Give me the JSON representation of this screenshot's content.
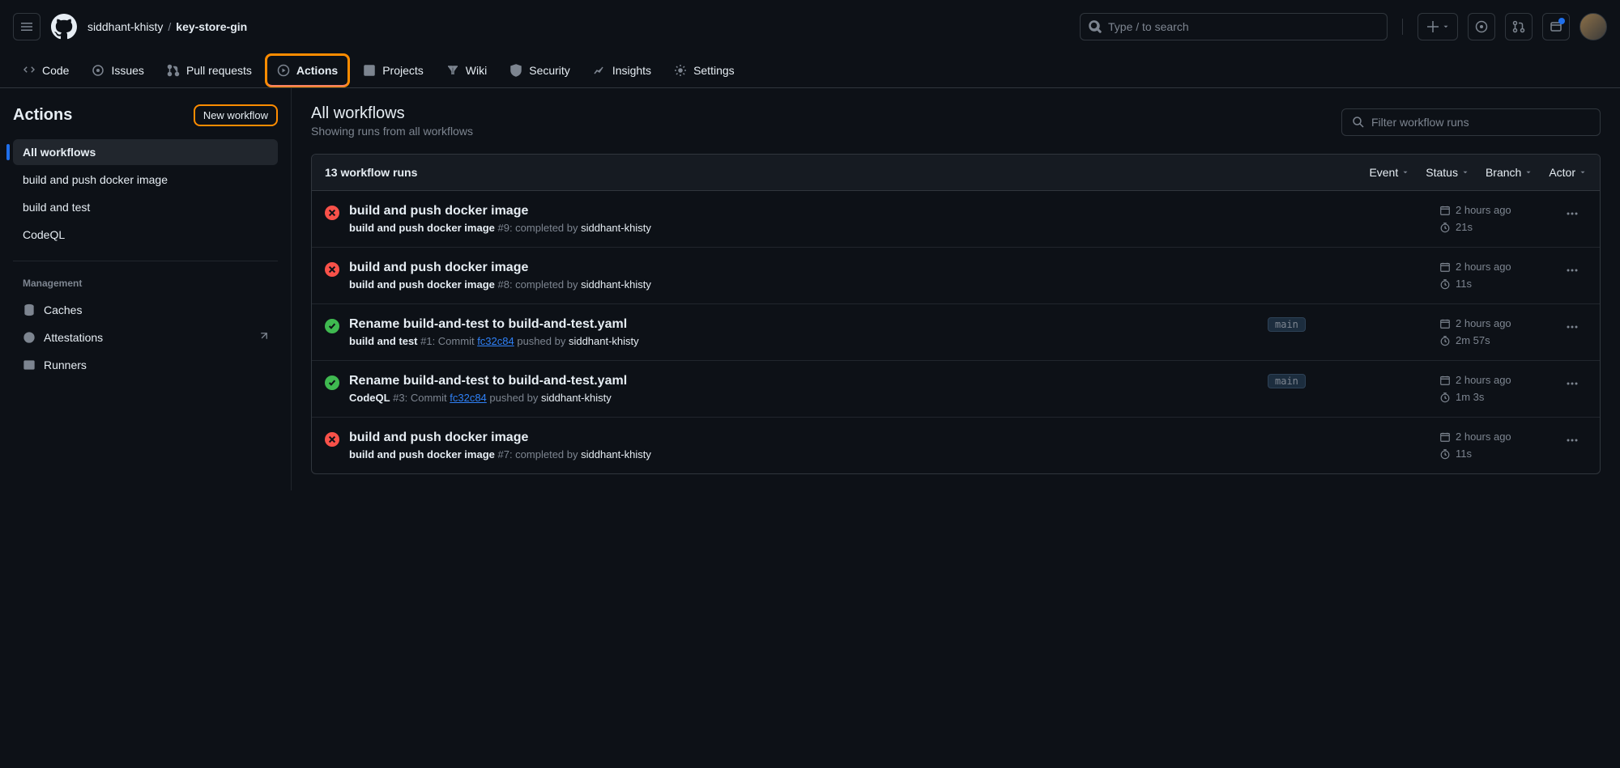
{
  "header": {
    "owner": "siddhant-khisty",
    "repo": "key-store-gin",
    "search_placeholder": "Type / to search"
  },
  "nav": {
    "code": "Code",
    "issues": "Issues",
    "pulls": "Pull requests",
    "actions": "Actions",
    "projects": "Projects",
    "wiki": "Wiki",
    "security": "Security",
    "insights": "Insights",
    "settings": "Settings"
  },
  "sidebar": {
    "title": "Actions",
    "new_workflow": "New workflow",
    "all_workflows": "All workflows",
    "workflows": [
      "build and push docker image",
      "build and test",
      "CodeQL"
    ],
    "management": "Management",
    "caches": "Caches",
    "attestations": "Attestations",
    "runners": "Runners"
  },
  "page": {
    "title": "All workflows",
    "subtitle": "Showing runs from all workflows",
    "filter_placeholder": "Filter workflow runs",
    "runs_count": "13 workflow runs",
    "filters": {
      "event": "Event",
      "status": "Status",
      "branch": "Branch",
      "actor": "Actor"
    }
  },
  "runs": [
    {
      "status": "fail",
      "title": "build and push docker image",
      "workflow": "build and push docker image",
      "run_number": "#9:",
      "action_text": "completed by",
      "commit": null,
      "pushed_by_prefix": null,
      "user": "siddhant-khisty",
      "branch": null,
      "time": "2 hours ago",
      "duration": "21s"
    },
    {
      "status": "fail",
      "title": "build and push docker image",
      "workflow": "build and push docker image",
      "run_number": "#8:",
      "action_text": "completed by",
      "commit": null,
      "pushed_by_prefix": null,
      "user": "siddhant-khisty",
      "branch": null,
      "time": "2 hours ago",
      "duration": "11s"
    },
    {
      "status": "success",
      "title": "Rename build-and-test to build-and-test.yaml",
      "workflow": "build and test",
      "run_number": "#1:",
      "action_text": "Commit",
      "commit": "fc32c84",
      "pushed_by_prefix": "pushed by",
      "user": "siddhant-khisty",
      "branch": "main",
      "time": "2 hours ago",
      "duration": "2m 57s"
    },
    {
      "status": "success",
      "title": "Rename build-and-test to build-and-test.yaml",
      "workflow": "CodeQL",
      "run_number": "#3:",
      "action_text": "Commit",
      "commit": "fc32c84",
      "pushed_by_prefix": "pushed by",
      "user": "siddhant-khisty",
      "branch": "main",
      "time": "2 hours ago",
      "duration": "1m 3s"
    },
    {
      "status": "fail",
      "title": "build and push docker image",
      "workflow": "build and push docker image",
      "run_number": "#7:",
      "action_text": "completed by",
      "commit": null,
      "pushed_by_prefix": null,
      "user": "siddhant-khisty",
      "branch": null,
      "time": "2 hours ago",
      "duration": "11s"
    }
  ]
}
